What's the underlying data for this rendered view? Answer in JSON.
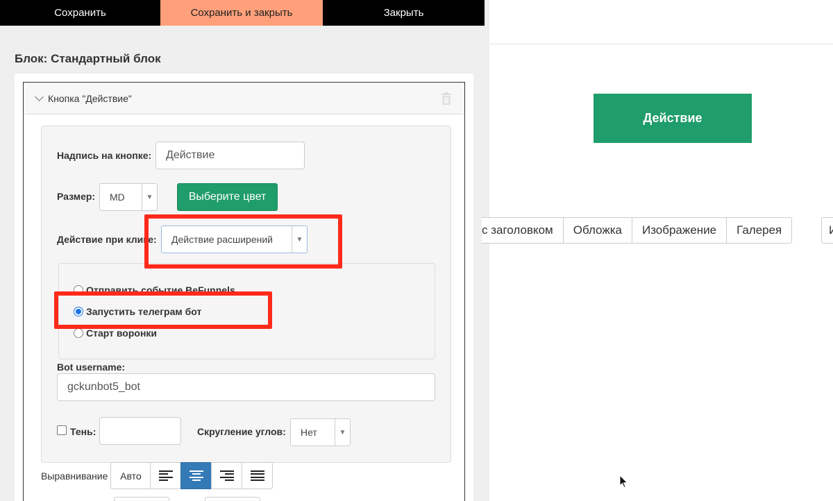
{
  "toolbar": {
    "save_label": "Сохранить",
    "save_close_label": "Сохранить и закрыть",
    "close_label": "Закрыть"
  },
  "block": {
    "title": "Блок: Стандартный блок",
    "accordion_title": "Кнопка \"Действие\""
  },
  "form": {
    "button_text_label": "Надпись на кнопке:",
    "button_text_value": "Действие",
    "size_label": "Размер:",
    "size_value": "MD",
    "color_button_label": "Выберите цвет",
    "click_action_label": "Действие при клике:",
    "click_action_value": "Действие расширений",
    "radio_options": [
      {
        "label": "Отправить событие BeFunnels",
        "selected": false
      },
      {
        "label": "Запустить телеграм бот",
        "selected": true
      },
      {
        "label": "Старт воронки",
        "selected": false
      }
    ],
    "bot_username_label": "Bot username:",
    "bot_username_value": "gckunbot5_bot",
    "shadow_label": "Тень:",
    "shadow_value": "",
    "corner_label": "Скругление углов:",
    "corner_value": "Нет",
    "align_label": "Выравнивание",
    "align_auto_label": "Авто",
    "align_icons": [
      "align-left-icon",
      "align-center-icon",
      "align-right-icon",
      "align-justify-icon"
    ],
    "align_active": "align-center-icon"
  },
  "preview": {
    "action_button_label": "Действие",
    "tabs": [
      "с заголовком",
      "Обложка",
      "Изображение",
      "Галерея"
    ],
    "tab_extra": "И"
  },
  "colors": {
    "accent_green": "#1f9d6a",
    "highlight_red": "#ff2a1a",
    "toolbar_active": "#ffa07a",
    "align_active": "#337ab7"
  }
}
